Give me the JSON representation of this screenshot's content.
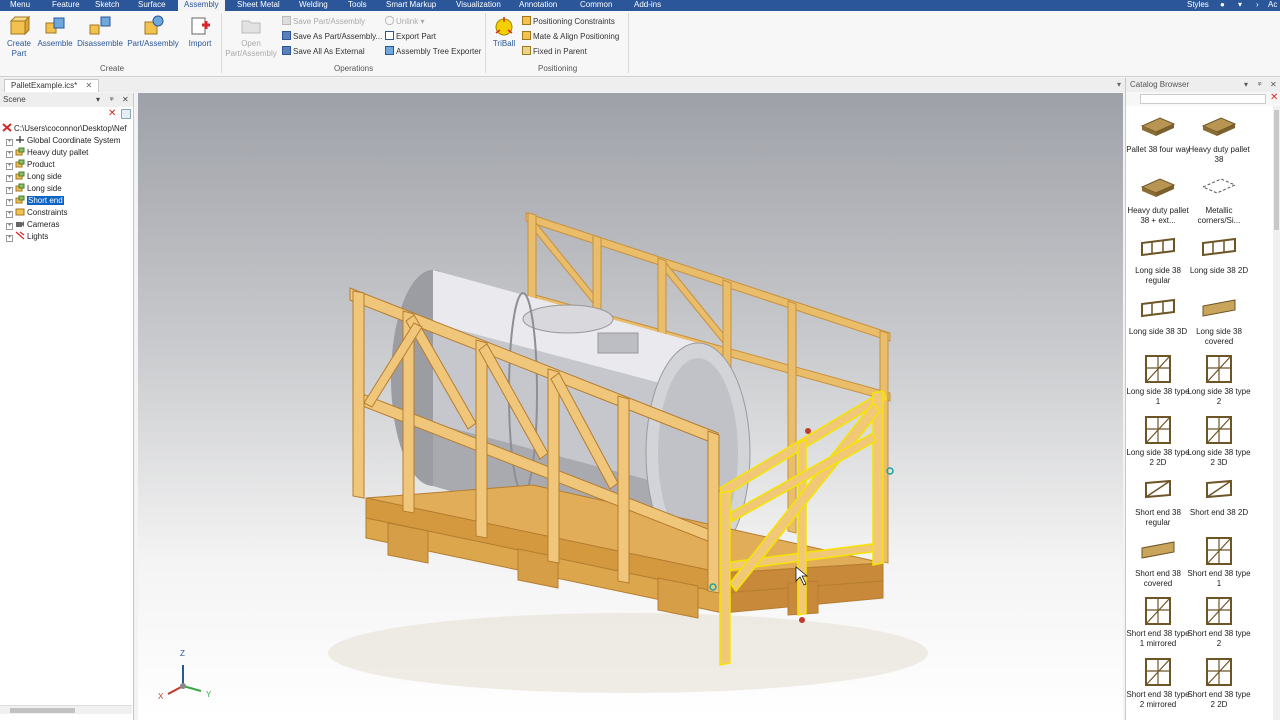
{
  "menu": {
    "tabs": [
      "Menu",
      "Feature",
      "Sketch",
      "Surface",
      "Assembly",
      "Sheet Metal",
      "Welding",
      "Tools",
      "Smart Markup",
      "Visualization",
      "Annotation",
      "Common",
      "Add-ins"
    ],
    "active_tab": "Assembly",
    "styles_label": "Styles",
    "right_fragment": "Ac"
  },
  "ribbon": {
    "create": {
      "group_label": "Create",
      "buttons": [
        "Create Part",
        "Assemble",
        "Disassemble",
        "Part/Assembly",
        "Import"
      ]
    },
    "operations": {
      "group_label": "Operations",
      "open_label": "Open Part/Assembly",
      "small_buttons": [
        "Save Part/Assembly",
        "Save As Part/Assembly...",
        "Save All As External",
        "Unlink",
        "Export Part",
        "Assembly Tree Exporter"
      ]
    },
    "positioning": {
      "group_label": "Positioning",
      "triball_label": "TriBall",
      "small_buttons": [
        "Positioning Constraints",
        "Mate & Align Positioning",
        "Fixed in Parent"
      ]
    }
  },
  "document": {
    "tab_label": "PalletExample.ics*"
  },
  "scene": {
    "title": "Scene",
    "items": [
      {
        "label": "C:\\Users\\coconnor\\Desktop\\Nef",
        "icon": "scene-root-icon"
      },
      {
        "label": "Global Coordinate System",
        "icon": "axes-icon"
      },
      {
        "label": "Heavy duty pallet",
        "icon": "assembly-icon"
      },
      {
        "label": "Product",
        "icon": "assembly-icon"
      },
      {
        "label": "Long side",
        "icon": "assembly-icon"
      },
      {
        "label": "Long side",
        "icon": "assembly-icon"
      },
      {
        "label": "Short end",
        "icon": "assembly-icon",
        "selected": true
      },
      {
        "label": "Constraints",
        "icon": "constraints-icon"
      },
      {
        "label": "Cameras",
        "icon": "camera-icon"
      },
      {
        "label": "Lights",
        "icon": "light-icon"
      }
    ]
  },
  "viewport": {
    "axis_labels": {
      "z": "Z",
      "x": "X",
      "y": "Y"
    }
  },
  "catalog": {
    "title": "Catalog Browser",
    "items": [
      "Pallet 38 four way",
      "Heavy duty pallet 38",
      "Heavy duty pallet 38 + ext...",
      "Metallic corners/Si...",
      "Long side 38 regular",
      "Long side 38 2D",
      "Long side 38 3D",
      "Long side 38 covered",
      "Long side 38 type 1",
      "Long side 38 type 2",
      "Long side 38 type 2 2D",
      "Long side 38 type 2 3D",
      "Short end 38 regular",
      "Short end 38 2D",
      "Short end 38 covered",
      "Short end 38 type 1",
      "Short end 38 type 1 mirrored",
      "Short end 38 type 2",
      "Short end 38 type 2 mirrored",
      "Short end 38 type 2 2D"
    ]
  },
  "colors": {
    "accent": "#2b579a",
    "selection": "#0a64c8",
    "wood": "#e8b660",
    "highlight": "#f5e400"
  }
}
